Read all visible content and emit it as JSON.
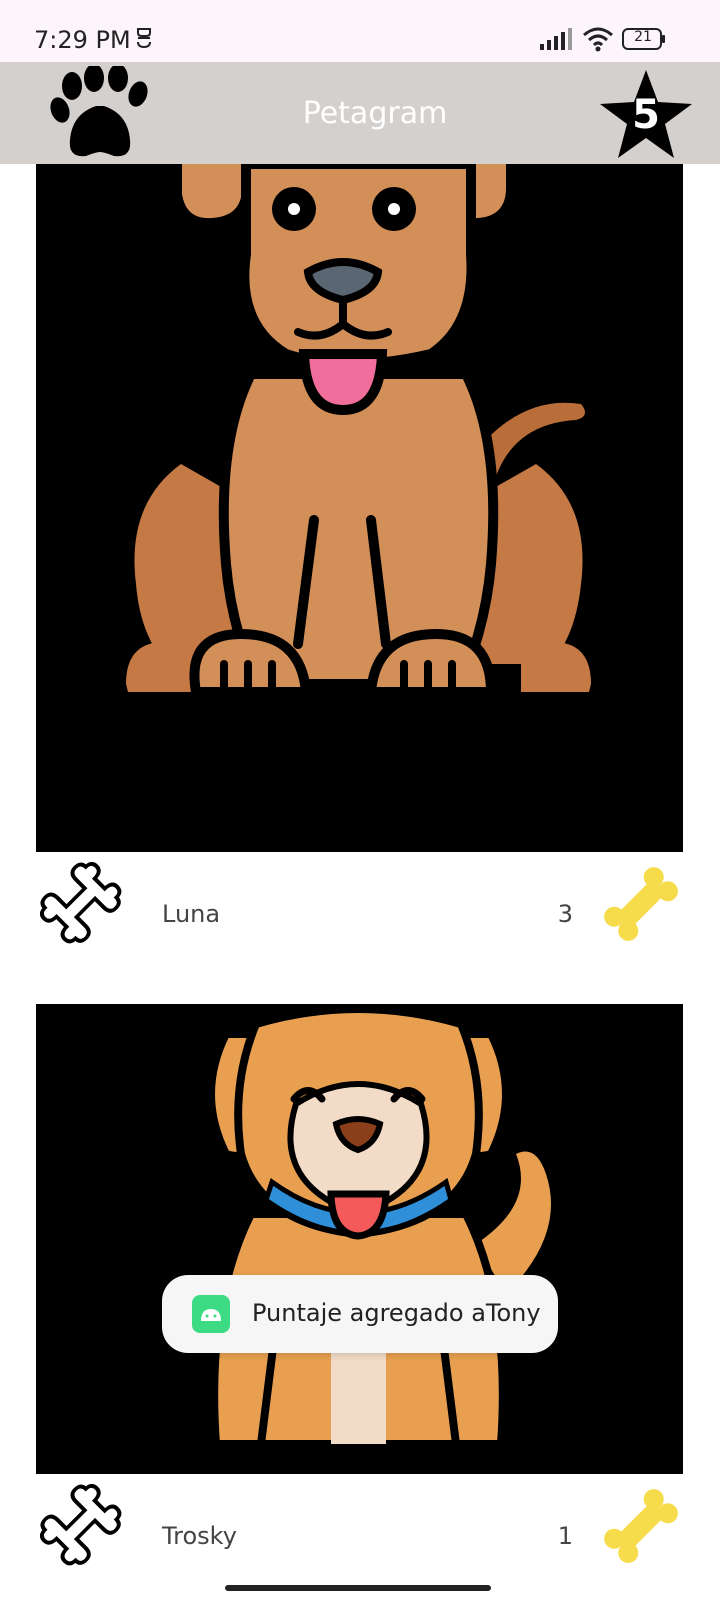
{
  "status_bar": {
    "time": "7:29 PM",
    "battery": "21",
    "icons": [
      "notification-icon",
      "signal-icon",
      "wifi-icon",
      "battery-icon"
    ]
  },
  "app_bar": {
    "title": "Petagram",
    "left_icon": "paw-icon",
    "right_icon": "star-icon",
    "star_count": "5",
    "background": "#d3d0ce"
  },
  "pets": [
    {
      "name": "Luna",
      "score": "3",
      "image": "brown-dog-illustration"
    },
    {
      "name": "Trosky",
      "score": "1",
      "image": "saint-bernard-dog-illustration"
    }
  ],
  "toast": {
    "message": "Puntaje agregado aTony",
    "icon": "android-app-icon"
  },
  "colors": {
    "bone_yellow": "#f6dc4a",
    "accent_brown": "#d38f58"
  }
}
